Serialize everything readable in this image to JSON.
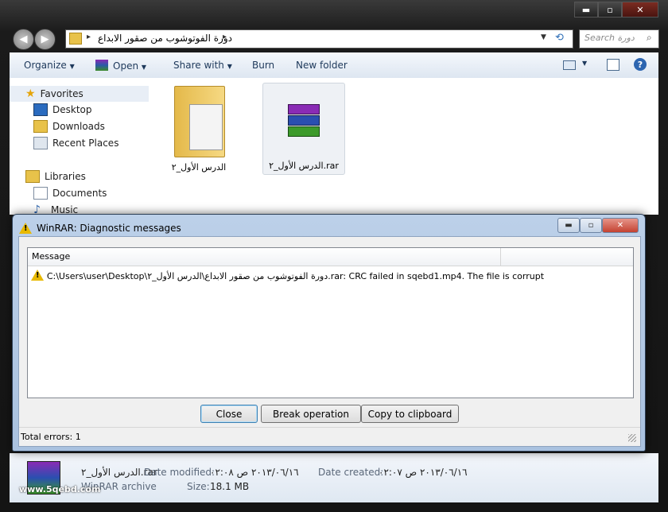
{
  "explorer": {
    "caption_buttons": {
      "minimize": "▬",
      "maximize": "▫",
      "close": "✕"
    },
    "address": "دورة الفوتوشوب من صقور الابداع",
    "search_placeholder": "Search دورة",
    "toolbar": {
      "organize": "Organize",
      "open": "Open",
      "share_with": "Share with",
      "burn": "Burn",
      "new_folder": "New folder"
    },
    "sidebar": {
      "favorites": "Favorites",
      "desktop": "Desktop",
      "downloads": "Downloads",
      "recent_places": "Recent Places",
      "libraries": "Libraries",
      "documents": "Documents",
      "music": "Music"
    },
    "files": [
      {
        "name": "الدرس الأول_٢",
        "icon": "folder-icon"
      },
      {
        "name": "الدرس الأول_٢.rar",
        "icon": "winrar-archive-icon"
      }
    ],
    "details": {
      "name": "الدرس الأول_٢.rar",
      "type": "WinRAR archive",
      "date_modified_label": "Date modified:",
      "date_modified": "٢٠١٣/٠٦/١٦ ص ٠٢:٠٨",
      "date_created_label": "Date created:",
      "date_created": "٢٠١٣/٠٦/١٦ ص ٠٢:٠٧",
      "size_label": "Size:",
      "size": "18.1 MB"
    },
    "watermark": "www.5qebd.com"
  },
  "dialog": {
    "title": "WinRAR: Diagnostic messages",
    "column_header": "Message",
    "messages": [
      "C:\\Users\\user\\Desktop\\دورة الفوتوشوب من صقور الابداع\\الدرس الأول_٢.rar: CRC failed in sqebd1.mp4. The file is corrupt"
    ],
    "buttons": {
      "close": "Close",
      "break_operation": "Break operation",
      "copy_to_clipboard": "Copy to clipboard"
    },
    "status": "Total errors: 1"
  }
}
